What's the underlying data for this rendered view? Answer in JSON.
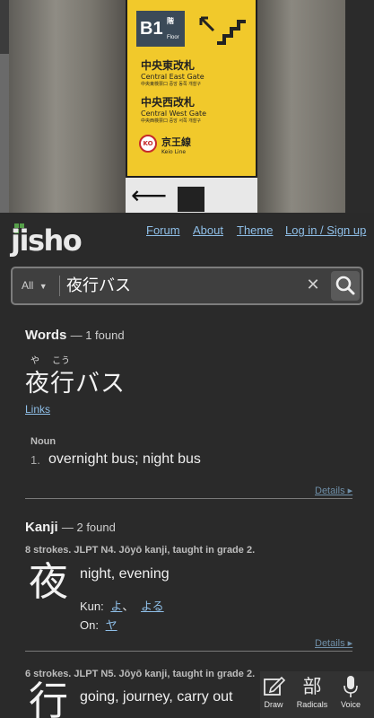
{
  "photo": {
    "sign": {
      "floor": "B1",
      "floor_kanji": "階",
      "floor_en": "Floor",
      "gates": [
        {
          "jp": "中央東改札",
          "en": "Central East Gate",
          "kr": "中央東検票口  중앙 동쪽 개찰구"
        },
        {
          "jp": "中央西改札",
          "en": "Central West Gate",
          "kr": "中央西検票口  중앙 서쪽 개찰구"
        }
      ],
      "line_code": "KO",
      "line_jp": "京王線",
      "line_en": "Keio Line"
    }
  },
  "header": {
    "logo": "jisho",
    "nav": [
      "Forum",
      "About",
      "Theme",
      "Log in / Sign up"
    ]
  },
  "search": {
    "filter": "All",
    "query": "夜行バス",
    "clear_icon": "close-icon",
    "search_icon": "search-icon"
  },
  "words": {
    "title": "Words",
    "count": "— 1 found",
    "entry": {
      "furigana": [
        "や",
        "こう"
      ],
      "text": "夜行バス",
      "links_label": "Links",
      "pos": "Noun",
      "sense_number": "1.",
      "sense": "overnight bus; night bus",
      "details": "Details ▸"
    }
  },
  "kanji": {
    "title": "Kanji",
    "count": "— 2 found",
    "items": [
      {
        "info": "8 strokes. JLPT N4. Jōyō kanji, taught in grade 2.",
        "char": "夜",
        "meaning": "night, evening",
        "kun_label": "Kun:",
        "kun": [
          "よ",
          "よる"
        ],
        "on_label": "On:",
        "on": [
          "ヤ"
        ],
        "details": "Details ▸"
      },
      {
        "info": "6 strokes. JLPT N5. Jōyō kanji, taught in grade 2.",
        "char": "行",
        "meaning": "going, journey, carry out"
      }
    ]
  },
  "tools": [
    {
      "label": "Draw",
      "icon": "pencil-icon"
    },
    {
      "label": "Radicals",
      "glyph": "部"
    },
    {
      "label": "Voice",
      "icon": "microphone-icon"
    }
  ]
}
